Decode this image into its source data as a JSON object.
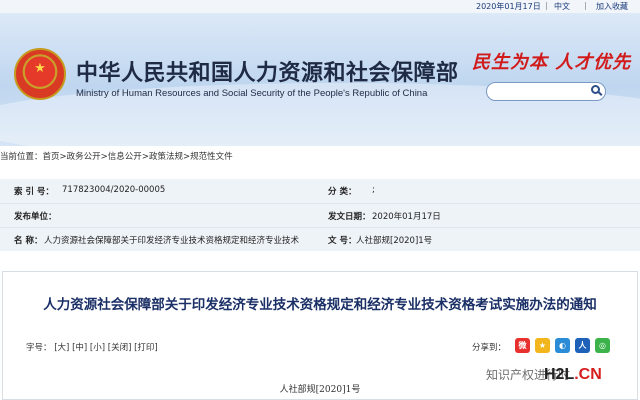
{
  "topbar": {
    "date": "2020年01月17日",
    "sep": "|",
    "lang": "中文",
    "favorite": "加入收藏"
  },
  "header": {
    "title_cn": "中华人民共和国人力资源和社会保障部",
    "title_en": "Ministry of Human Resources and Social Security of the People's Republic of China",
    "slogan": "民生为本  人才优先",
    "search_placeholder": ""
  },
  "breadcrumb": {
    "prefix": "当前位置：",
    "items": [
      "首页",
      "政务公开",
      "信息公开",
      "政策法规",
      "规范性文件"
    ],
    "sep": ">"
  },
  "meta": {
    "index_label": "索 引 号：",
    "index_value": "717823004/2020-00005",
    "category_label": "分      类：",
    "category_value": ";",
    "issuer_label": "发布单位：",
    "issuer_value": "",
    "date_label": "发文日期：",
    "date_value": "2020年01月17日",
    "name_label": "名      称：",
    "name_value": "人力资源社会保障部关于印发经济专业技术资格规定和经济专业技术",
    "docno_label": "文      号：",
    "docno_value": "人社部规[2020]1号"
  },
  "article": {
    "title": "人力资源社会保障部关于印发经济专业技术资格规定和经济专业技术资格考试实施办法的通知",
    "font_label": "字号：",
    "font_options": [
      "[大]",
      "[中]",
      "[小]",
      "[关闭]",
      "[打印]"
    ],
    "share_label": "分享到：",
    "doc_number": "人社部规[2020]1号"
  },
  "share_icons": [
    "weibo-icon",
    "qzone-icon",
    "tencent-weibo-icon",
    "renren-icon",
    "wechat-icon"
  ],
  "watermark": {
    "text": "知识产权进行时",
    "logo_main": "H2L",
    "logo_tail": ".CN"
  }
}
